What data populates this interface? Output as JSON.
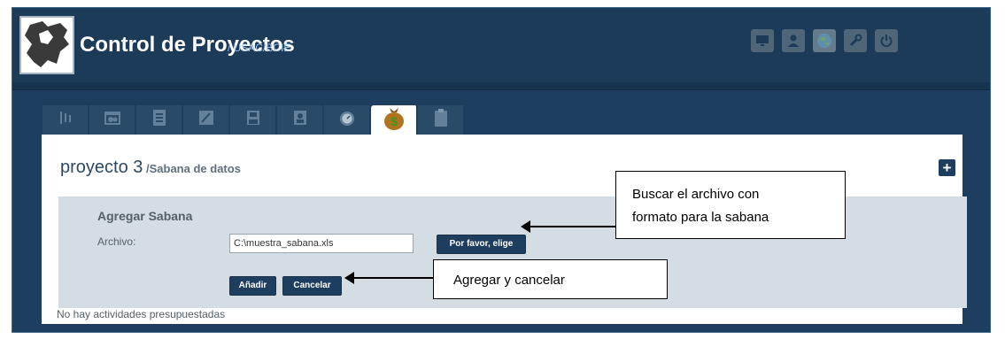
{
  "header": {
    "app_title": "Control de Proyectos",
    "app_subtitle": "/ USAC/BCIE",
    "tool_icons": [
      "monitor-icon",
      "user-icon",
      "globe-icon",
      "wrench-icon",
      "power-icon"
    ]
  },
  "tabs": [
    {
      "icon": "timeline-icon"
    },
    {
      "icon": "calendar-icon"
    },
    {
      "icon": "clipboard-list-icon"
    },
    {
      "icon": "edit-note-icon"
    },
    {
      "icon": "save-disk-icon"
    },
    {
      "icon": "person-badge-icon"
    },
    {
      "icon": "stopwatch-icon"
    },
    {
      "icon": "money-bag-icon",
      "active": true
    },
    {
      "icon": "clipboard-icon"
    }
  ],
  "page": {
    "title": "proyecto 3",
    "subtitle": " /Sabana de datos"
  },
  "form": {
    "title": "Agregar Sabana",
    "file_label": "Archivo:",
    "file_value": "C:\\muestra_sabana.xls",
    "browse_label": "Por favor, elige",
    "add_label": "Añadir",
    "cancel_label": "Cancelar"
  },
  "status": {
    "no_activities": "No hay actividades presupuestadas"
  },
  "callouts": {
    "browse_line1": "Buscar el archivo  con",
    "browse_line2": "formato para la sabana",
    "actions": "Agregar y cancelar"
  },
  "colors": {
    "header_bg": "#1b3b59",
    "button_bg": "#1d3e5e",
    "form_bg": "#d4dce4"
  }
}
